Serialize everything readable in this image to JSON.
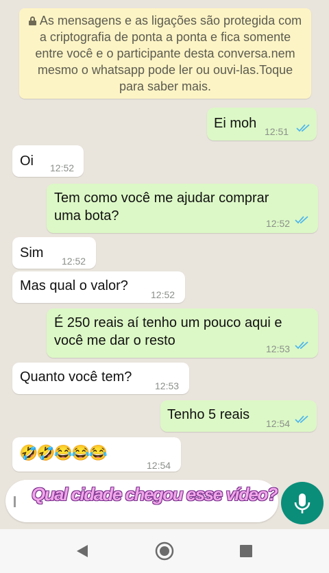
{
  "notice": {
    "text": "As mensagens e as ligações são protegida com a criptografia de ponta a ponta e fica somente entre você e o participante desta conversa.nem mesmo o whatsapp pode ler ou ouvi-las.Toque para saber mais."
  },
  "messages": [
    {
      "direction": "outgoing",
      "text": "Ei moh",
      "time": "12:51",
      "status": "read"
    },
    {
      "direction": "incoming",
      "text": "Oi",
      "time": "12:52"
    },
    {
      "direction": "outgoing",
      "text_line1": "Tem como você me ajudar comprar",
      "text_line2": "uma bota?",
      "time": "12:52",
      "status": "read"
    },
    {
      "direction": "incoming",
      "text": "Sim",
      "time": "12:52"
    },
    {
      "direction": "incoming",
      "text": "Mas qual o valor?",
      "time": "12:52"
    },
    {
      "direction": "outgoing",
      "text_line1": "É 250 reais aí tenho um pouco aqui e",
      "text_line2": "você me dar o resto",
      "time": "12:53",
      "status": "read"
    },
    {
      "direction": "incoming",
      "text": "Quanto você tem?",
      "time": "12:53"
    },
    {
      "direction": "outgoing",
      "text": "Tenho 5 reais",
      "time": "12:54",
      "status": "read"
    },
    {
      "direction": "incoming",
      "text": "🤣🤣😂😂😂",
      "time": "12:54"
    }
  ],
  "overlay": {
    "caption": "Qual cidade chegou esse vídeo?"
  },
  "colors": {
    "chat_background": "#e9e4dc",
    "outgoing_bubble": "#dcf8c6",
    "incoming_bubble": "#ffffff",
    "notice_background": "#fdf4c5",
    "read_ticks": "#4fb6ec",
    "mic_button": "#0a8e7a"
  },
  "icons": {
    "notice": "lock-icon",
    "read_status": "double-check-icon",
    "mic": "microphone-icon",
    "nav": [
      "back-triangle-icon",
      "home-circle-icon",
      "recents-square-icon"
    ]
  }
}
